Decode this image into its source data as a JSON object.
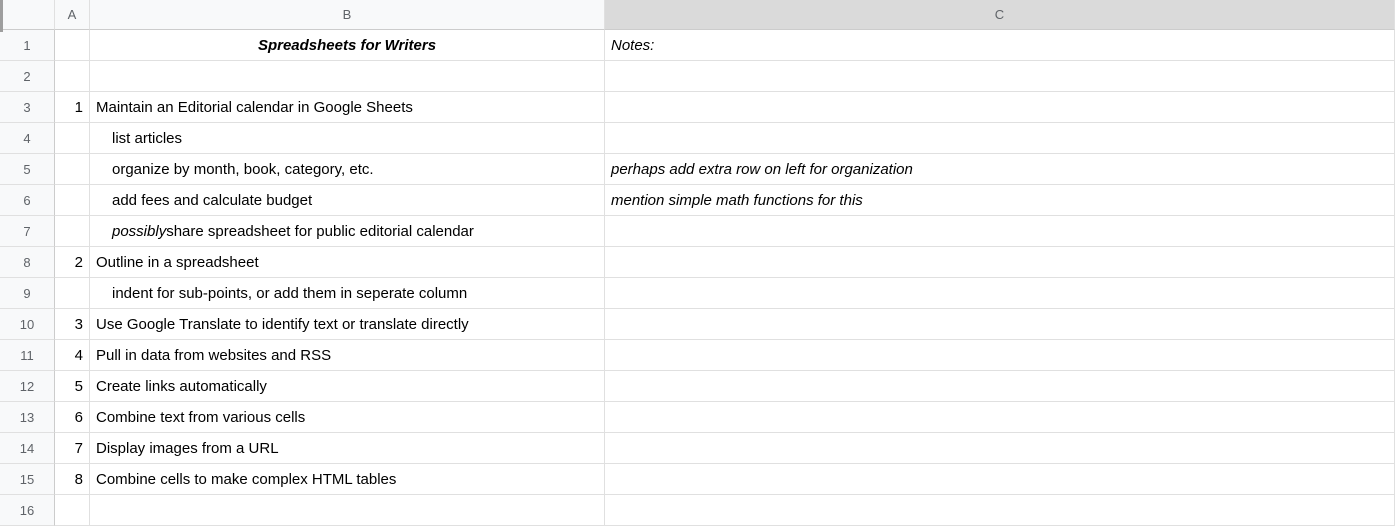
{
  "columns": {
    "a": "A",
    "b": "B",
    "c": "C"
  },
  "rowNumbers": [
    "1",
    "2",
    "3",
    "4",
    "5",
    "6",
    "7",
    "8",
    "9",
    "10",
    "11",
    "12",
    "13",
    "14",
    "15",
    "16"
  ],
  "rows": [
    {
      "a": "",
      "b": "Spreadsheets for Writers",
      "c": "Notes:"
    },
    {
      "a": "",
      "b": "",
      "c": ""
    },
    {
      "a": "1",
      "b": "Maintain an Editorial calendar in Google Sheets",
      "c": ""
    },
    {
      "a": "",
      "b": "list articles",
      "c": ""
    },
    {
      "a": "",
      "b": "organize by month, book, category, etc.",
      "c": "perhaps add extra row on left for organization"
    },
    {
      "a": "",
      "b": "add fees and calculate budget",
      "c": "mention simple math functions for this"
    },
    {
      "a": "",
      "b_prefix": "possibly",
      "b_rest": " share spreadsheet for public editorial calendar",
      "c": ""
    },
    {
      "a": "2",
      "b": "Outline in a spreadsheet",
      "c": ""
    },
    {
      "a": "",
      "b": "indent for sub-points, or add them in seperate column",
      "c": ""
    },
    {
      "a": "3",
      "b": "Use Google Translate to identify text or translate directly",
      "c": ""
    },
    {
      "a": "4",
      "b": "Pull in data from websites and RSS",
      "c": ""
    },
    {
      "a": "5",
      "b": "Create links automatically",
      "c": ""
    },
    {
      "a": "6",
      "b": "Combine text from various cells",
      "c": ""
    },
    {
      "a": "7",
      "b": "Display images from a URL",
      "c": ""
    },
    {
      "a": "8",
      "b": "Combine cells to make complex HTML tables",
      "c": ""
    },
    {
      "a": "",
      "b": "",
      "c": ""
    }
  ]
}
